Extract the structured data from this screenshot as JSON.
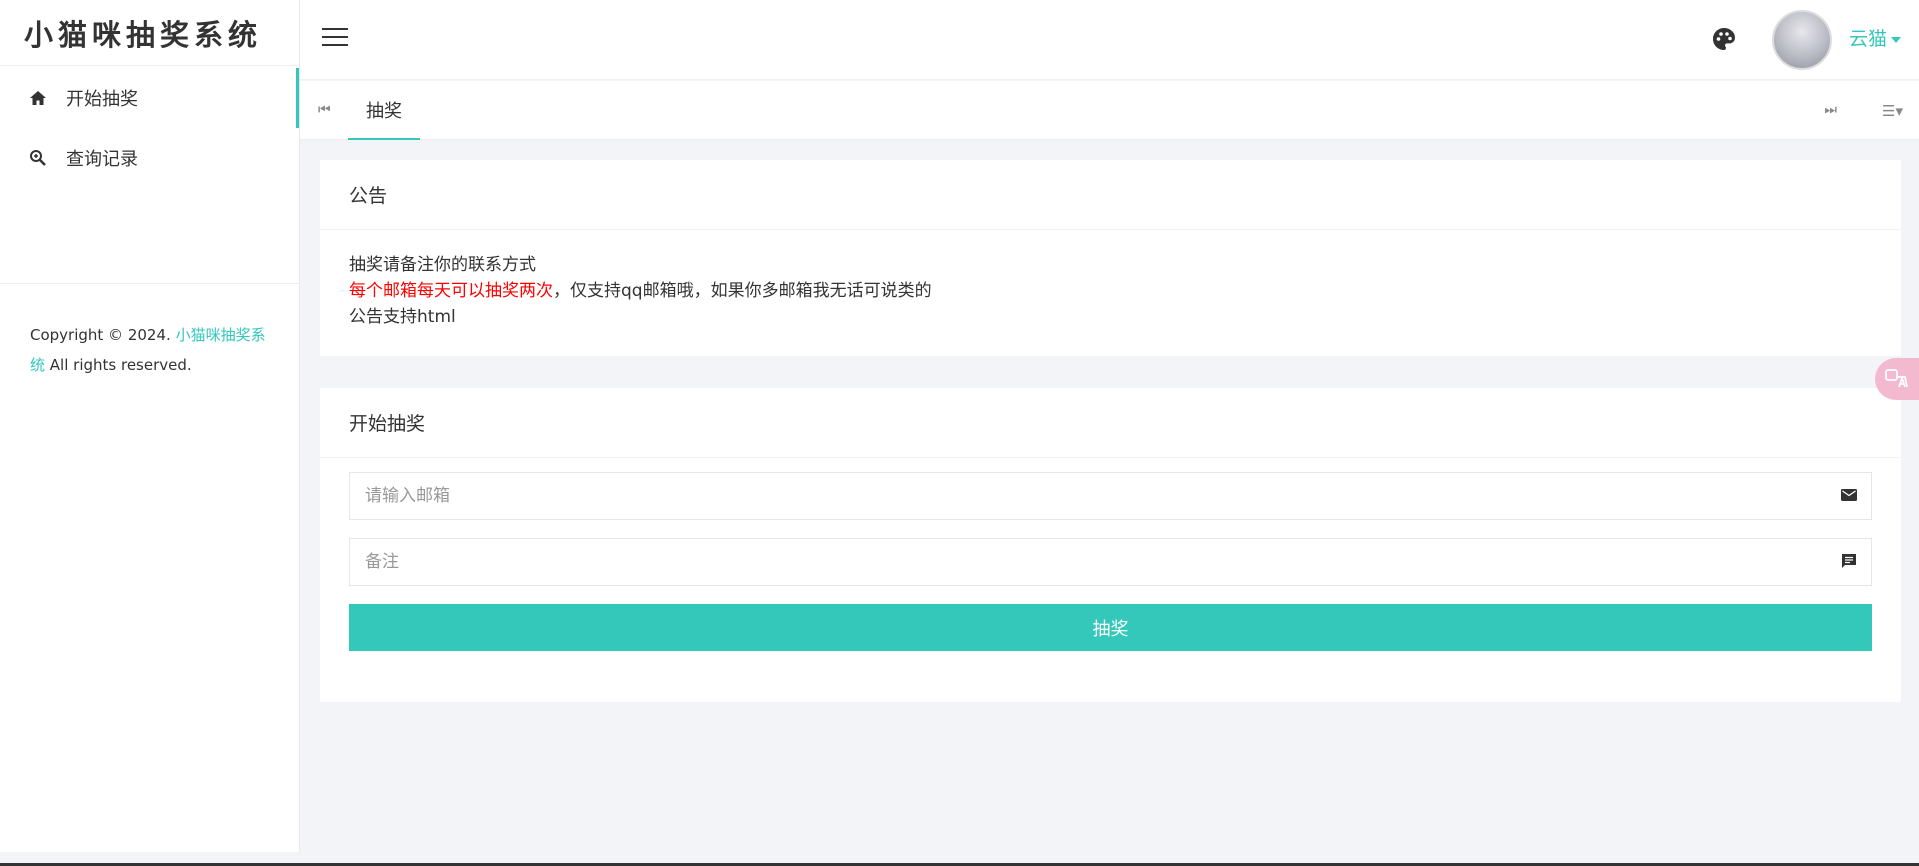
{
  "sidebar": {
    "brand": "小猫咪抽奖系统",
    "items": [
      {
        "label": "开始抽奖",
        "icon": "home-icon"
      },
      {
        "label": "查询记录",
        "icon": "search-zoom-icon"
      }
    ],
    "copyright_prefix": "Copyright © 2024.",
    "copyright_link": "小猫咪抽奖系统",
    "copyright_suffix": "All rights reserved."
  },
  "topbar": {
    "username": "云猫"
  },
  "tabs": [
    {
      "label": "抽奖",
      "active": true
    }
  ],
  "notice": {
    "title": "公告",
    "line1": "抽奖请备注你的联系方式",
    "line2_red": "每个邮箱每天可以抽奖两次",
    "line2_rest": "，仅支持qq邮箱哦，如果你多邮箱我无话可说类的",
    "line3": "公告支持html"
  },
  "lottery": {
    "title": "开始抽奖",
    "email_placeholder": "请输入邮箱",
    "remark_placeholder": "备注",
    "submit_label": "抽奖"
  },
  "colors": {
    "accent": "#34c8bb",
    "notice_red": "#ff0000"
  }
}
